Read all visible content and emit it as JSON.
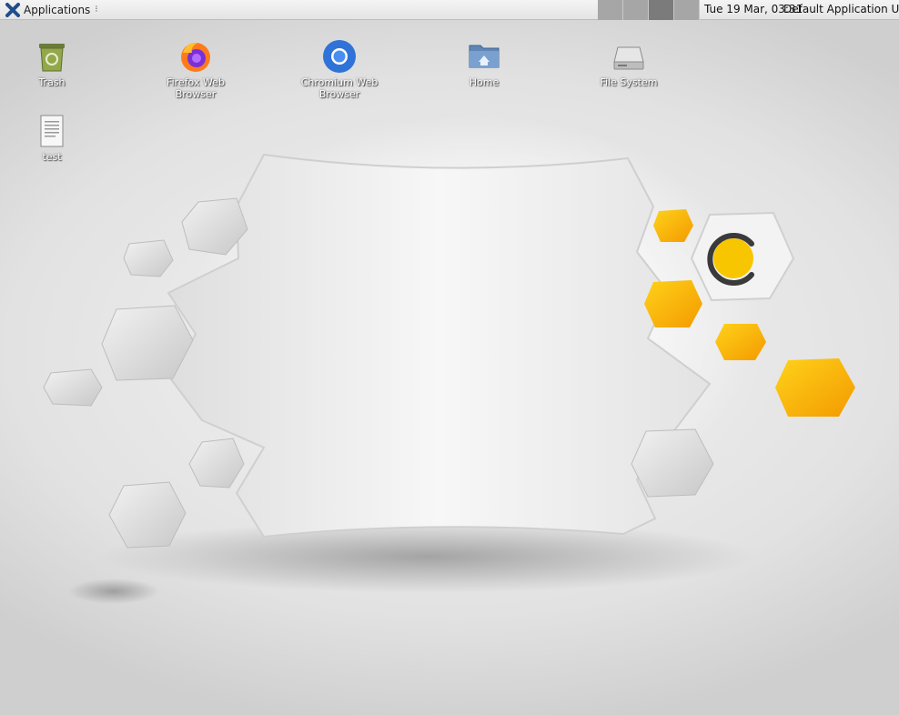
{
  "panel": {
    "applications_label": "Applications",
    "applications_icon": "xfce-logo-icon",
    "workspaces": [
      {
        "name": "workspace-1",
        "active": false
      },
      {
        "name": "workspace-2",
        "active": false
      },
      {
        "name": "workspace-3",
        "active": true
      },
      {
        "name": "workspace-4",
        "active": false
      }
    ],
    "clock": "Tue 19 Mar, 03:31",
    "user": "Default Application User"
  },
  "desktop": {
    "icons": [
      {
        "label": "Trash",
        "icon": "trash-icon"
      },
      {
        "label": "Firefox Web Browser",
        "icon": "firefox-icon"
      },
      {
        "label": "Chromium Web Browser",
        "icon": "chromium-icon"
      },
      {
        "label": "Home",
        "icon": "home-folder-icon"
      },
      {
        "label": "File System",
        "icon": "drive-icon"
      },
      {
        "label": "test",
        "icon": "text-file-icon"
      }
    ]
  },
  "colors": {
    "accent_yellow": "#f7b500",
    "hex_grey": "#d9d9d9",
    "panel_bg": "#ececec"
  }
}
